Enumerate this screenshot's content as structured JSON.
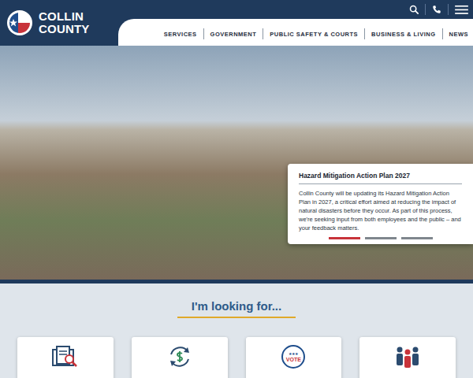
{
  "header": {
    "logo_lines": [
      "COLLIN",
      "COUNTY"
    ]
  },
  "nav": {
    "items": [
      {
        "label": "SERVICES"
      },
      {
        "label": "GOVERNMENT"
      },
      {
        "label": "PUBLIC SAFETY & COURTS"
      },
      {
        "label": "BUSINESS & LIVING"
      },
      {
        "label": "NEWS"
      }
    ]
  },
  "slide": {
    "title": "Hazard Mitigation Action Plan 2027",
    "body": "Collin County will be updating its Hazard Mitigation Action Plan in 2027, a critical effort aimed at reducing the impact of natural disasters before they occur. As part of this process, we're seeking input from both employees and the public – and your feedback matters.",
    "indicators": [
      {
        "selected": true
      },
      {
        "selected": false
      },
      {
        "selected": false
      }
    ]
  },
  "looking_for": {
    "heading": "I'm looking for...",
    "cards": [
      {
        "kind": "records"
      },
      {
        "kind": "payments"
      },
      {
        "kind": "vote",
        "badge": "VOTE"
      },
      {
        "kind": "community"
      }
    ]
  }
}
